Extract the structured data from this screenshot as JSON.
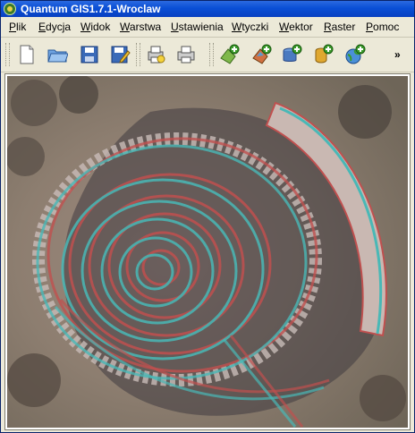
{
  "window": {
    "title": "Quantum GIS1.7.1-Wroclaw"
  },
  "menu": [
    "Plik",
    "Edycja",
    "Widok",
    "Warstwa",
    "Ustawienia",
    "Wtyczki",
    "Wektor",
    "Raster",
    "Pomoc"
  ],
  "toolbar": {
    "buttons": [
      "new-project-icon",
      "open-project-icon",
      "save-project-icon",
      "save-as-icon",
      "print-composer-icon",
      "print-icon",
      "add-vector-layer-icon",
      "add-raster-layer-icon",
      "add-postgis-layer-icon",
      "add-spatialite-layer-icon",
      "add-wms-layer-icon"
    ],
    "overflow_label": "»"
  },
  "map": {
    "description_colors": {
      "red": "#c0504f",
      "cyan": "#49b8b6",
      "gray": "#8f8273"
    }
  }
}
